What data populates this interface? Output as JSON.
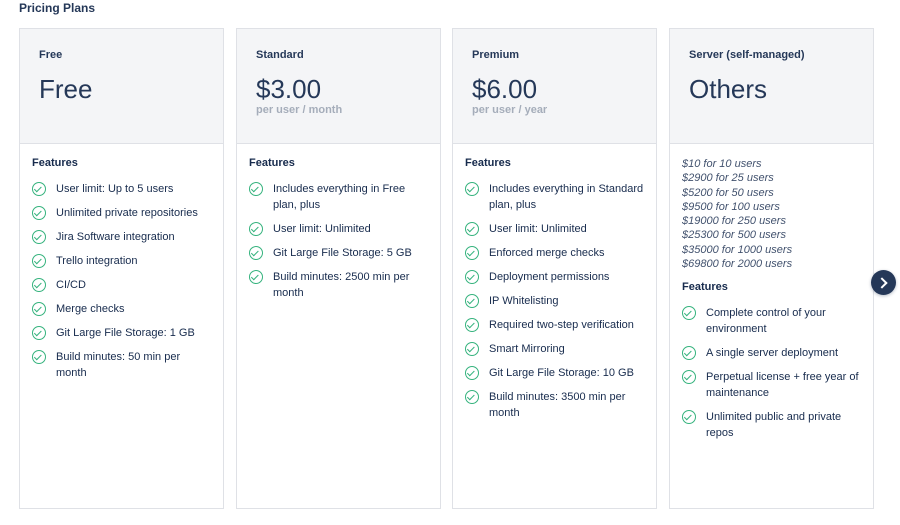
{
  "page": {
    "title": "Pricing Plans"
  },
  "plans": [
    {
      "name": "Free",
      "price": "Free",
      "period": "",
      "features_heading": "Features",
      "features": [
        "User limit: Up to 5 users",
        "Unlimited private repositories",
        "Jira Software integration",
        "Trello integration",
        "CI/CD",
        "Merge checks",
        "Git Large File Storage: 1 GB",
        "Build minutes: 50 min per month"
      ]
    },
    {
      "name": "Standard",
      "price": "$3.00",
      "period": "per user / month",
      "features_heading": "Features",
      "features": [
        "Includes everything in Free plan, plus",
        "User limit: Unlimited",
        "Git Large File Storage: 5 GB",
        "Build minutes: 2500 min per month"
      ]
    },
    {
      "name": "Premium",
      "price": "$6.00",
      "period": "per user / year",
      "features_heading": "Features",
      "features": [
        "Includes everything in Standard plan, plus",
        "User limit: Unlimited",
        "Enforced merge checks",
        "Deployment permissions",
        "IP Whitelisting",
        "Required two-step verification",
        "Smart Mirroring",
        "Git Large File Storage: 10 GB",
        "Build minutes: 3500 min per month"
      ]
    },
    {
      "name": "Server (self-managed)",
      "price": "Others",
      "period": "",
      "pricing_tiers": [
        "$10 for 10 users",
        "$2900 for 25 users",
        "$5200 for 50 users",
        "$9500 for 100 users",
        "$19000 for 250 users",
        "$25300 for 500 users",
        "$35000 for 1000 users",
        "$69800 for 2000 users"
      ],
      "features_heading": "Features",
      "features": [
        "Complete control of your environment",
        "A single server deployment",
        "Perpetual license + free year of maintenance",
        "Unlimited public and private repos"
      ]
    }
  ],
  "carousel": {
    "next_icon": "chevron-right-icon"
  },
  "colors": {
    "header_bg": "#f4f5f7",
    "text_primary": "#253858",
    "muted": "#a5adba",
    "check_green": "#36b37e",
    "next_button_bg": "#253858"
  }
}
